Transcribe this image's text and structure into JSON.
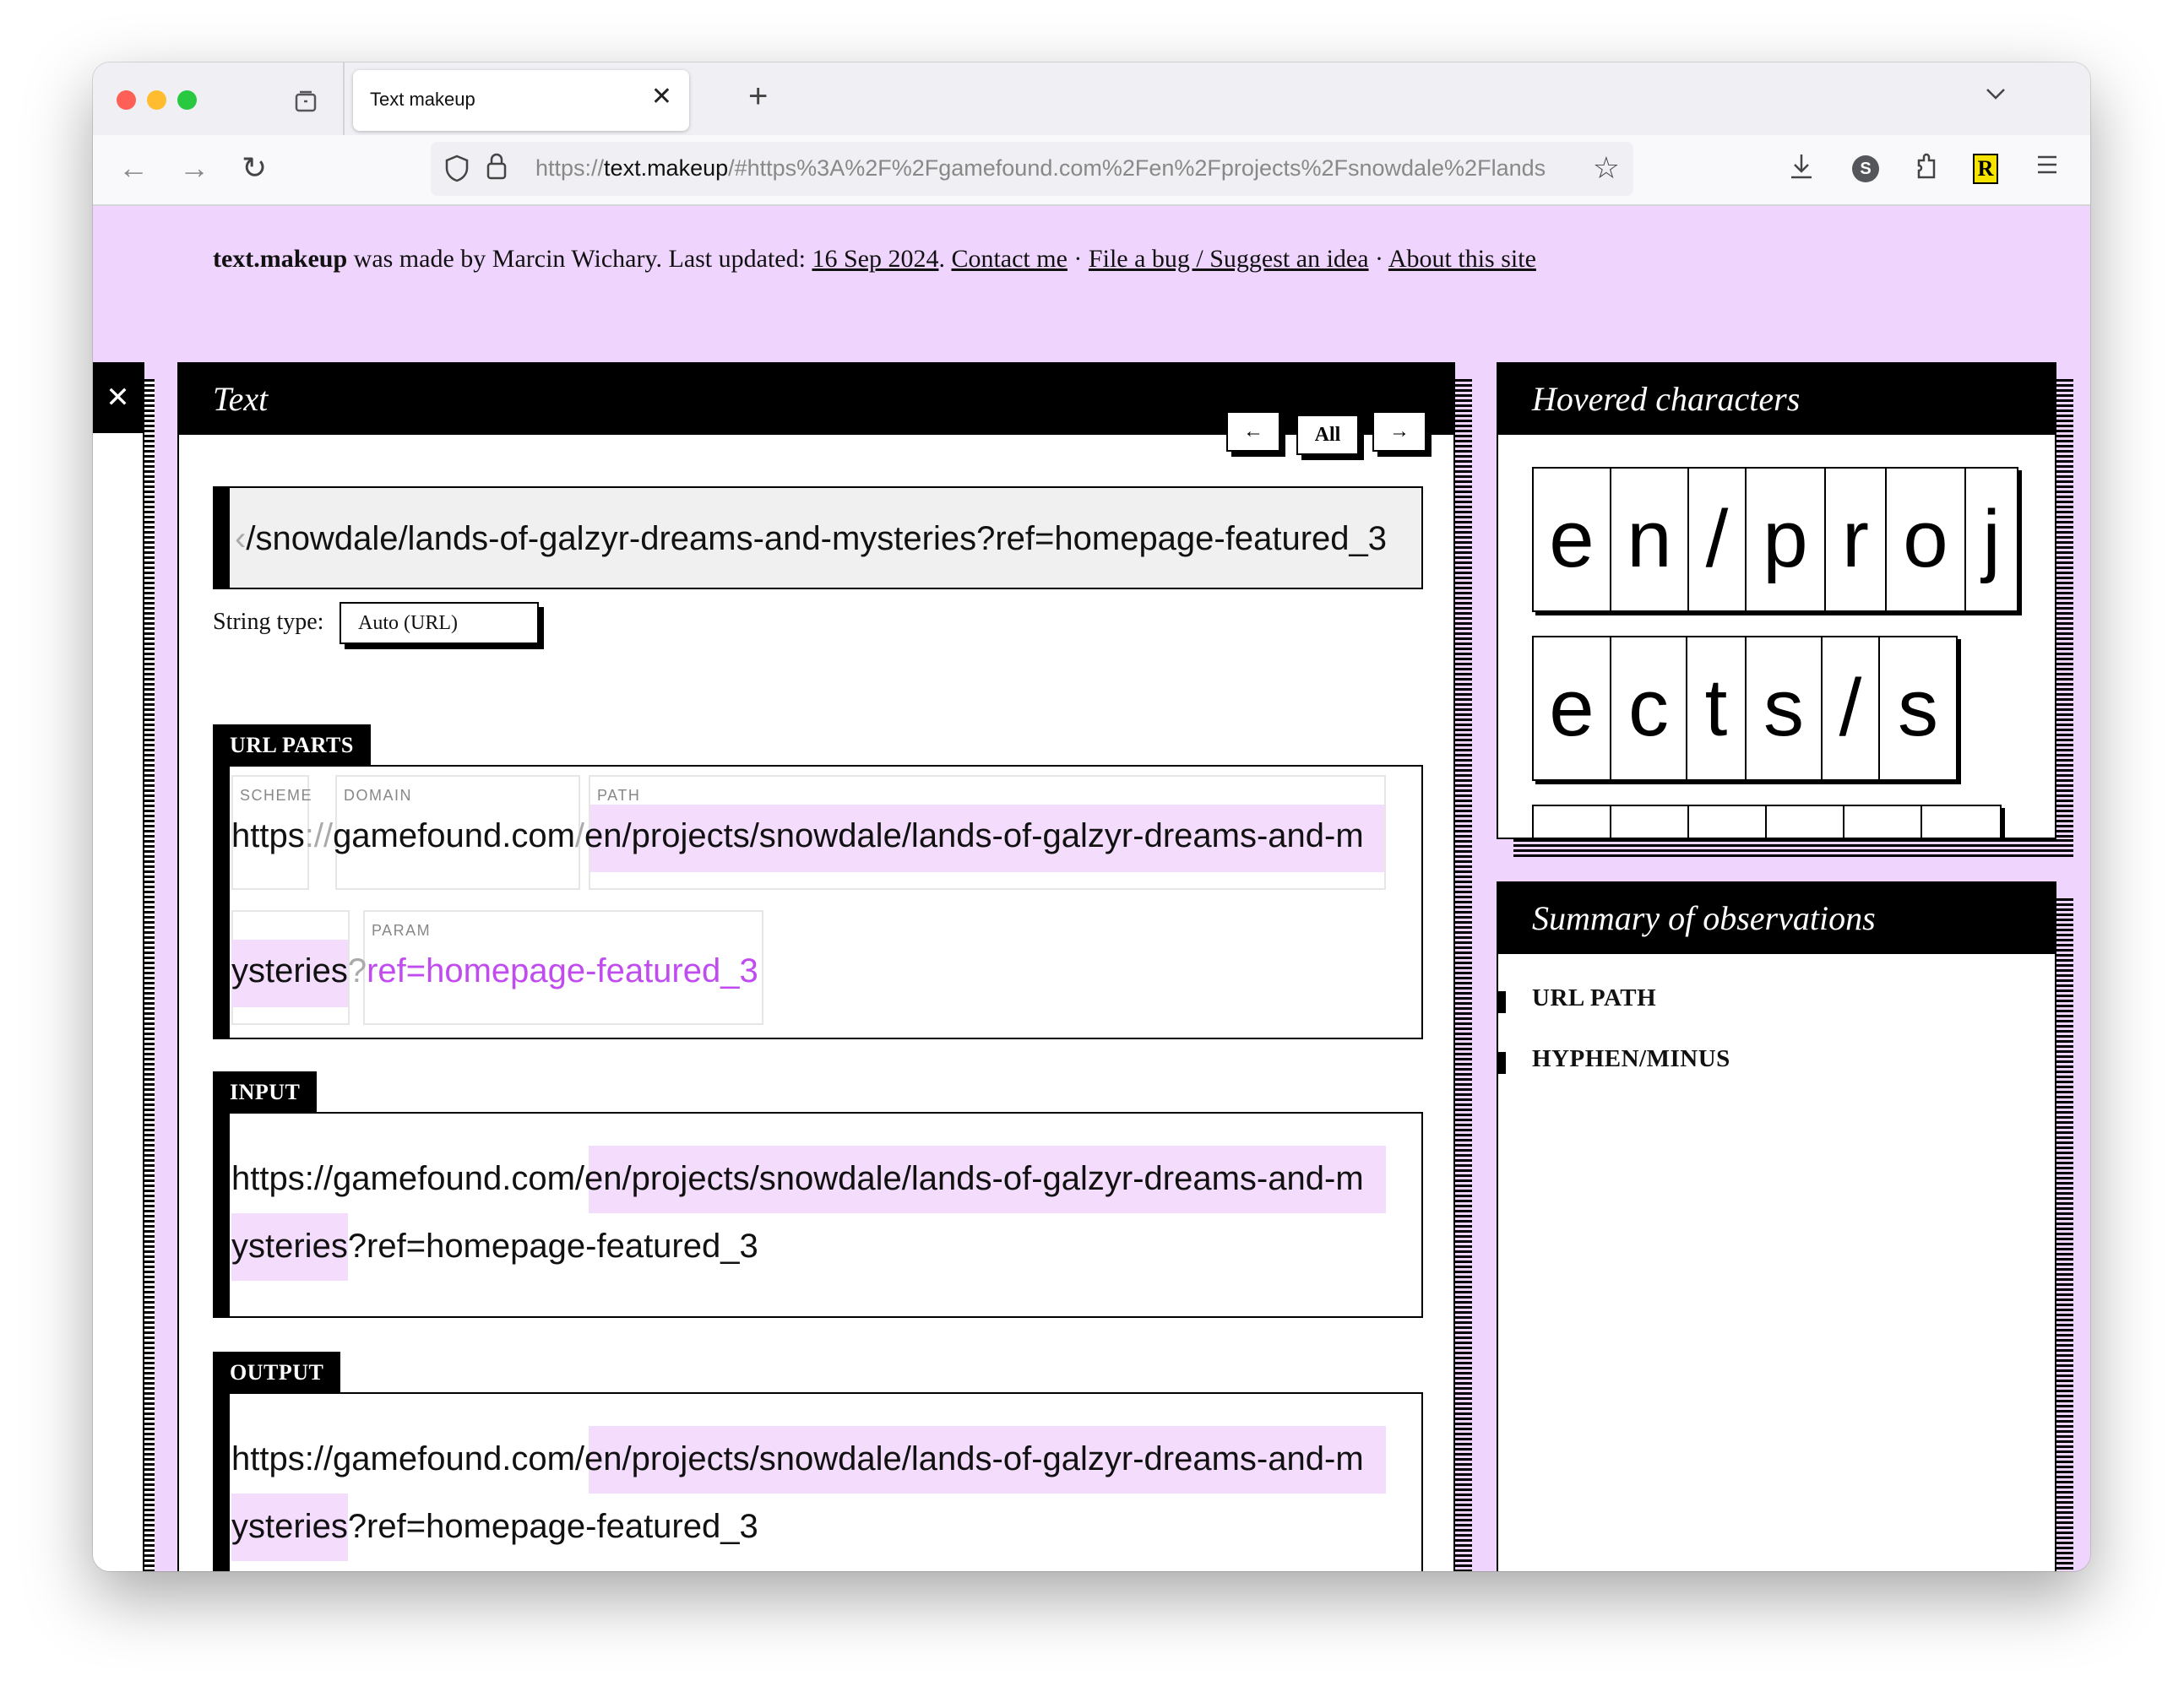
{
  "browser": {
    "tab_title": "Text makeup",
    "url_scheme": "https://",
    "url_host": "text.makeup",
    "url_rest": "/#https%3A%2F%2Fgamefound.com%2Fen%2Fprojects%2Fsnowdale%2Flands",
    "icons": {
      "sidebar": "sidebar-icon",
      "close_tab": "✕",
      "new_tab": "+",
      "tab_list": "⌄",
      "back": "←",
      "forward": "→",
      "reload": "↻",
      "shield": "⛉",
      "lock": "🔒",
      "bookmark": "☆",
      "download": "⤓",
      "s_ext": "S",
      "extensions": "⧉",
      "r_ext": "R",
      "menu": "≡"
    }
  },
  "credits": {
    "brand": "text.makeup",
    "made_by": " was made by Marcin Wichary. Last updated: ",
    "date": "16 Sep 2024",
    "sep1": ". ",
    "contact": "Contact me",
    "dot1": " · ",
    "bug": "File a bug / Suggest an idea",
    "dot2": " · ",
    "about": "About this site"
  },
  "left_stub": {
    "close": "✕"
  },
  "text_panel": {
    "title": "Text",
    "prev": "←",
    "all": "All",
    "next": "→",
    "input_prefix": "‹",
    "input_value": "/snowdale/lands-of-galzyr-dreams-and-mysteries?ref=homepage-featured_3",
    "string_type_label": "String type:",
    "string_type_value": "Auto (URL)",
    "url_parts": {
      "tag": "URL PARTS",
      "scheme_label": "SCHEME",
      "scheme": "https",
      "scheme_sep": "://",
      "domain_label": "DOMAIN",
      "domain": "gamefound.com",
      "domain_sep": "/",
      "path_label": "PATH",
      "path_line1": "en/projects/snowdale/lands-of-galzyr-dreams-and-m",
      "path_line2": "ysteries",
      "param_sep": "?",
      "param_label": "PARAM",
      "param": "ref=homepage-featured_3"
    },
    "input": {
      "tag": "INPUT",
      "line1_plain": "https://gamefound.com/",
      "line1_hl": "en/projects/snowdale/lands-of-galzyr-dreams-and-m",
      "line2_hl": "ysteries",
      "line2_plain": "?ref=homepage-featured_3"
    },
    "output": {
      "tag": "OUTPUT",
      "line1_plain": "https://gamefound.com/",
      "line1_hl": "en/projects/snowdale/lands-of-galzyr-dreams-and-m",
      "line2_hl": "ysteries",
      "line2_plain": "?ref=homepage-featured_3"
    }
  },
  "hovered_panel": {
    "title": "Hovered characters",
    "row1": [
      "e",
      "n",
      "/",
      "p",
      "r",
      "o",
      "j"
    ],
    "row2": [
      "e",
      "c",
      "t",
      "s",
      "/",
      "s"
    ],
    "row3": [
      "",
      "",
      "",
      "",
      "",
      ""
    ]
  },
  "summary_panel": {
    "title": "Summary of observations",
    "items": [
      "URL PATH",
      "HYPHEN/MINUS"
    ]
  },
  "colors": {
    "page_bg": "#efd5fd",
    "highlight": "#f3dcfc",
    "param": "#c04cf0"
  }
}
